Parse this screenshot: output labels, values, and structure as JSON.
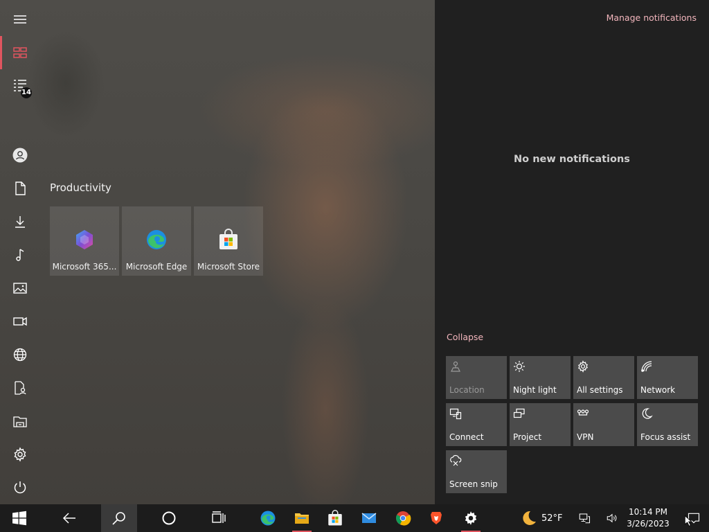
{
  "start": {
    "rail_badge": "14",
    "group_title": "Productivity",
    "tiles": [
      {
        "label": "Microsoft 365..."
      },
      {
        "label": "Microsoft Edge"
      },
      {
        "label": "Microsoft Store"
      }
    ]
  },
  "action_center": {
    "manage_label": "Manage notifications",
    "empty_label": "No new notifications",
    "collapse_label": "Collapse",
    "quick_actions": [
      {
        "label": "Location",
        "icon": "location-icon",
        "enabled": false
      },
      {
        "label": "Night light",
        "icon": "night-light-icon",
        "enabled": true
      },
      {
        "label": "All settings",
        "icon": "gear-icon",
        "enabled": true
      },
      {
        "label": "Network",
        "icon": "network-icon",
        "enabled": true
      },
      {
        "label": "Connect",
        "icon": "connect-icon",
        "enabled": true
      },
      {
        "label": "Project",
        "icon": "project-icon",
        "enabled": true
      },
      {
        "label": "VPN",
        "icon": "vpn-icon",
        "enabled": true
      },
      {
        "label": "Focus assist",
        "icon": "moon-icon",
        "enabled": true
      },
      {
        "label": "Screen snip",
        "icon": "screen-snip-icon",
        "enabled": true
      }
    ]
  },
  "taskbar": {
    "weather_temp": "52°F",
    "time": "10:14 PM",
    "date": "3/26/2023"
  },
  "colors": {
    "accent": "#e0555f",
    "link": "#f3b6bd",
    "panel_bg": "#202020",
    "tile_bg": "#4b4b4b",
    "taskbar_bg": "#1c1c1c"
  }
}
